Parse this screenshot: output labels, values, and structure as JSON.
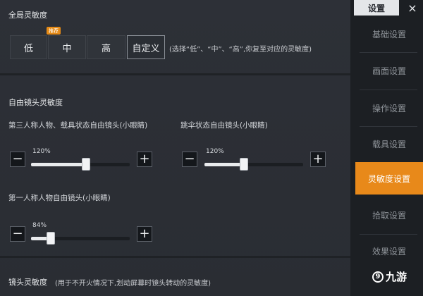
{
  "global_sensitivity": {
    "title": "全局灵敏度",
    "options": [
      "低",
      "中",
      "高",
      "自定义"
    ],
    "selected": "自定义",
    "badge": "推荐",
    "hint": "(选择“低”、“中”、“高”,你复至对应的灵敏度)"
  },
  "free_camera": {
    "title": "自由镜头灵敏度",
    "sliders": [
      {
        "label": "第三人称人物、载具状态自由镜头(小眼睛)",
        "value": "120%",
        "fraction": 0.56
      },
      {
        "label": "跳伞状态自由镜头(小眼睛)",
        "value": "120%",
        "fraction": 0.4
      },
      {
        "label": "第一人称人物自由镜头(小眼睛)",
        "value": "84%",
        "fraction": 0.2
      }
    ],
    "minus": "−",
    "plus": "+"
  },
  "camera_sensitivity": {
    "title": "镜头灵敏度",
    "hint": "(用于不开火情况下,划动屏幕时镜头转动的灵敏度)"
  },
  "sidebar": {
    "header": "设置",
    "close": "×",
    "items": [
      "基础设置",
      "画面设置",
      "操作设置",
      "载具设置",
      "灵敏度设置",
      "拾取设置",
      "效果设置"
    ],
    "active": "灵敏度设置"
  },
  "watermark": {
    "text": "九游",
    "logo": "9"
  },
  "colors": {
    "accent": "#e8891a",
    "panel": "#2b2e34",
    "sidebar": "#1c1f23"
  }
}
